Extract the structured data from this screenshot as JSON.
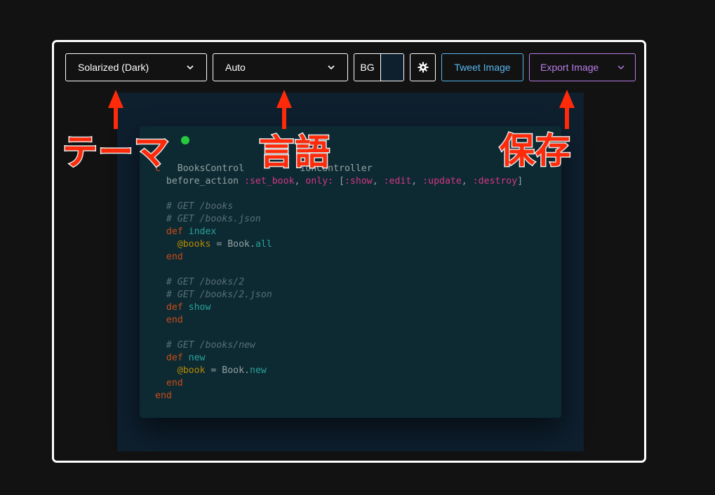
{
  "toolbar": {
    "theme": "Solarized (Dark)",
    "language": "Auto",
    "bg_label": "BG",
    "bg_color": "#0e1f2e",
    "settings_icon": "gear-icon",
    "tweet_label": "Tweet Image",
    "export_label": "Export Image",
    "dropdown_icon": "chevron-down-icon"
  },
  "annotations": {
    "theme": "テーマ",
    "language": "言語",
    "save": "保存"
  },
  "colors": {
    "annotation": "#ff2a0a",
    "tweet": "#57b7f0",
    "export": "#b87ee6",
    "window": "#0d2a33"
  },
  "code": {
    "lines": [
      [
        {
          "t": "c",
          "c": "kw"
        },
        {
          "t": "   BooksControl",
          "c": "nc"
        },
        {
          "t": "          ",
          "c": "nc"
        },
        {
          "t": "ionController",
          "c": "nc"
        }
      ],
      [
        {
          "t": "  before_action ",
          "c": "nc"
        },
        {
          "t": ":set_book",
          "c": "sym"
        },
        {
          "t": ", ",
          "c": "nc"
        },
        {
          "t": "only:",
          "c": "sym"
        },
        {
          "t": " [",
          "c": "nc"
        },
        {
          "t": ":show",
          "c": "sym"
        },
        {
          "t": ", ",
          "c": "nc"
        },
        {
          "t": ":edit",
          "c": "sym"
        },
        {
          "t": ", ",
          "c": "nc"
        },
        {
          "t": ":update",
          "c": "sym"
        },
        {
          "t": ", ",
          "c": "nc"
        },
        {
          "t": ":destroy",
          "c": "sym"
        },
        {
          "t": "]",
          "c": "nc"
        }
      ],
      [],
      [
        {
          "t": "  # GET /books",
          "c": "cm"
        }
      ],
      [
        {
          "t": "  # GET /books.json",
          "c": "cm"
        }
      ],
      [
        {
          "t": "  def ",
          "c": "kw"
        },
        {
          "t": "index",
          "c": "fn"
        }
      ],
      [
        {
          "t": "    @books",
          "c": "iv"
        },
        {
          "t": " = Book.",
          "c": "nc"
        },
        {
          "t": "all",
          "c": "fn"
        }
      ],
      [
        {
          "t": "  end",
          "c": "kw"
        }
      ],
      [],
      [
        {
          "t": "  # GET /books/2",
          "c": "cm"
        }
      ],
      [
        {
          "t": "  # GET /books/2.json",
          "c": "cm"
        }
      ],
      [
        {
          "t": "  def ",
          "c": "kw"
        },
        {
          "t": "show",
          "c": "fn"
        }
      ],
      [
        {
          "t": "  end",
          "c": "kw"
        }
      ],
      [],
      [
        {
          "t": "  # GET /books/new",
          "c": "cm"
        }
      ],
      [
        {
          "t": "  def ",
          "c": "kw"
        },
        {
          "t": "new",
          "c": "fn"
        }
      ],
      [
        {
          "t": "    @book",
          "c": "iv"
        },
        {
          "t": " = Book.",
          "c": "nc"
        },
        {
          "t": "new",
          "c": "fn"
        }
      ],
      [
        {
          "t": "  end",
          "c": "kw"
        }
      ],
      [
        {
          "t": "end",
          "c": "kw"
        }
      ]
    ]
  }
}
